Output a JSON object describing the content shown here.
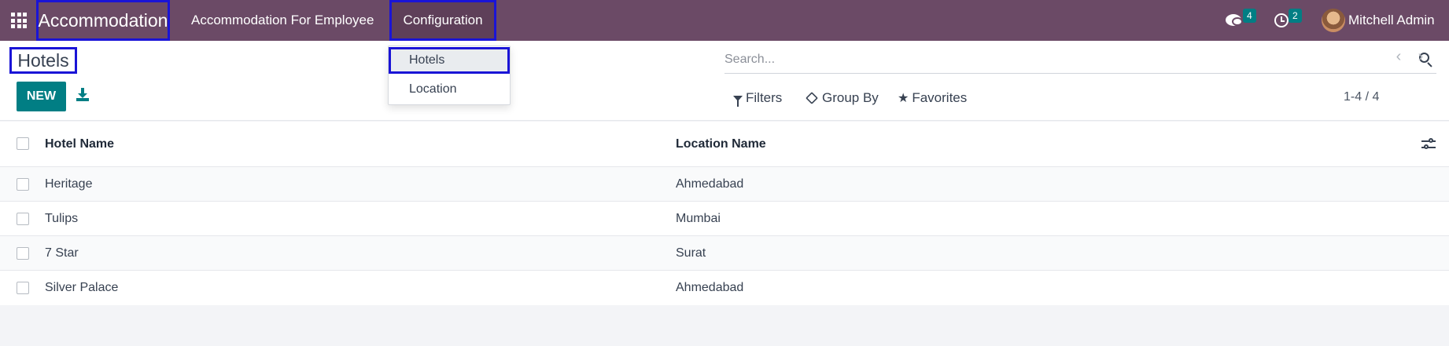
{
  "navbar": {
    "brand": "Accommodation",
    "menu": [
      {
        "label": "Accommodation For Employee"
      },
      {
        "label": "Configuration"
      }
    ],
    "messages_count": "4",
    "activities_count": "2",
    "user_name": "Mitchell Admin"
  },
  "dropdown": {
    "items": [
      {
        "label": "Hotels"
      },
      {
        "label": "Location"
      }
    ]
  },
  "control_panel": {
    "title": "Hotels",
    "new_label": "NEW",
    "search_placeholder": "Search...",
    "filters_label": "Filters",
    "group_by_label": "Group By",
    "favorites_label": "Favorites",
    "pager": "1-4 / 4"
  },
  "list": {
    "columns": [
      "Hotel Name",
      "Location Name"
    ],
    "rows": [
      {
        "hotel": "Heritage",
        "location": "Ahmedabad"
      },
      {
        "hotel": "Tulips",
        "location": "Mumbai"
      },
      {
        "hotel": "7 Star",
        "location": "Surat"
      },
      {
        "hotel": "Silver Palace",
        "location": "Ahmedabad"
      }
    ]
  },
  "colors": {
    "navbar": "#6b4a66",
    "primary": "#017e84",
    "highlight_border": "#1a14d6"
  }
}
